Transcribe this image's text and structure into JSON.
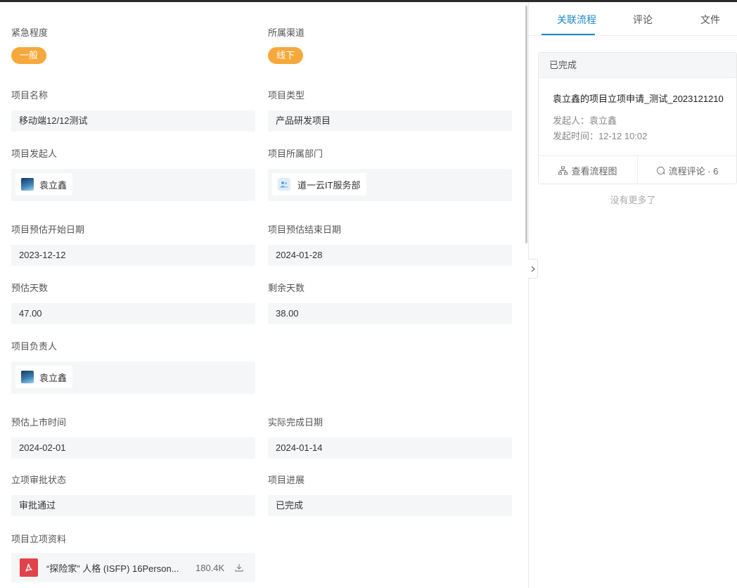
{
  "form": {
    "urgency": {
      "label": "紧急程度",
      "value": "一般"
    },
    "channel": {
      "label": "所属渠道",
      "value": "线下"
    },
    "project_name": {
      "label": "项目名称",
      "value": "移动端12/12测试"
    },
    "project_type": {
      "label": "项目类型",
      "value": "产品研发项目"
    },
    "initiator": {
      "label": "项目发起人",
      "value": "袁立鑫"
    },
    "department": {
      "label": "项目所属部门",
      "value": "道一云IT服务部"
    },
    "est_start": {
      "label": "项目预估开始日期",
      "value": "2023-12-12"
    },
    "est_end": {
      "label": "项目预估结束日期",
      "value": "2024-01-28"
    },
    "est_days": {
      "label": "预估天数",
      "value": "47.00"
    },
    "remaining_days": {
      "label": "剩余天数",
      "value": "38.00"
    },
    "owner": {
      "label": "项目负责人",
      "value": "袁立鑫"
    },
    "launch_time": {
      "label": "预估上市时间",
      "value": "2024-02-01"
    },
    "actual_done": {
      "label": "实际完成日期",
      "value": "2024-01-14"
    },
    "approval_status": {
      "label": "立项审批状态",
      "value": "审批通过"
    },
    "progress": {
      "label": "项目进展",
      "value": "已完成"
    },
    "attachment": {
      "label": "项目立项资料",
      "file_name": "“探险家” 人格 (ISFP) 16Person...",
      "file_size": "180.4K",
      "file_icon": "pdf-icon"
    }
  },
  "panel": {
    "tabs": [
      "关联流程",
      "评论",
      "文件"
    ],
    "active_tab": 0,
    "card": {
      "status": "已完成",
      "title": "袁立鑫的项目立项申请_测试_2023121210",
      "initiator_line": "发起人：袁立鑫",
      "time_line": "发起时间：12-12 10:02",
      "view_flow": "查看流程图",
      "flow_comments": "流程评论 · 6"
    },
    "no_more": "没有更多了"
  },
  "colors": {
    "accent": "#1d87c9",
    "tag": "#f5a93b",
    "pdf": "#e2424a"
  }
}
